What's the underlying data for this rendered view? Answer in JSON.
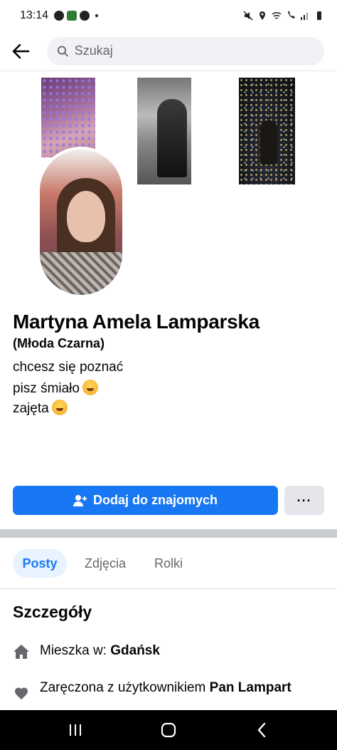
{
  "status_bar": {
    "time": "13:14"
  },
  "header": {
    "search_placeholder": "Szukaj"
  },
  "profile": {
    "name": "Martyna Amela Lamparska",
    "alias": "(Młoda Czarna)",
    "bio": [
      "chcesz się poznać",
      "pisz śmiało",
      "zajęta"
    ]
  },
  "actions": {
    "add_friend_label": "Dodaj do znajomych",
    "more_label": "···"
  },
  "tabs": [
    "Posty",
    "Zdjęcia",
    "Rolki"
  ],
  "details": {
    "title": "Szczegóły",
    "lives_prefix": "Mieszka w: ",
    "lives_city": "Gdańsk",
    "relationship_prefix": "Zaręczona z użytkownikiem ",
    "relationship_partner": "Pan Lampart"
  },
  "icons": {
    "back": "arrow-left-icon",
    "search": "search-icon",
    "add_friend": "person-plus-icon",
    "home": "home-icon",
    "heart": "heart-icon"
  },
  "colors": {
    "accent": "#1877f2",
    "tab_active_bg": "#e7f3ff"
  }
}
